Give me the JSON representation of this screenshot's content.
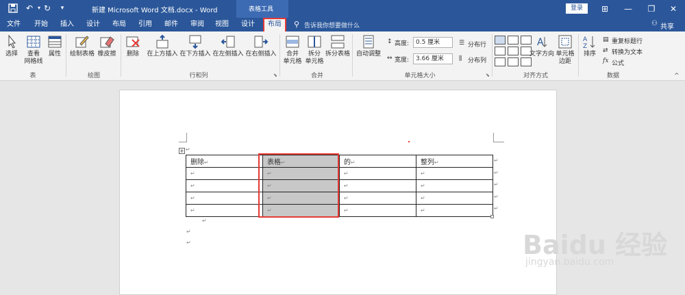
{
  "titlebar": {
    "title": "新建 Microsoft Word 文档.docx  -  Word",
    "context_tools": "表格工具",
    "login": "登录"
  },
  "tabs": [
    "文件",
    "开始",
    "插入",
    "设计",
    "布局",
    "引用",
    "邮件",
    "审阅",
    "视图",
    "设计",
    "布局"
  ],
  "tell_me": "告诉我你想要做什么",
  "share": "共享",
  "ribbon": {
    "table_group": {
      "label": "表",
      "select": "选择",
      "gridlines": "查看\n网格线",
      "properties": "属性"
    },
    "draw_group": {
      "label": "绘图",
      "draw_table": "绘制表格",
      "eraser": "橡皮擦"
    },
    "rowcol_group": {
      "label": "行和列",
      "delete": "删除",
      "insert_above": "在上方插入",
      "insert_below": "在下方插入",
      "insert_left": "在左侧插入",
      "insert_right": "在右侧插入"
    },
    "merge_group": {
      "label": "合并",
      "merge_cells": "合并\n单元格",
      "split_cells": "拆分\n单元格",
      "split_table": "拆分表格"
    },
    "cellsize_group": {
      "label": "单元格大小",
      "autofit": "自动调整",
      "height_label": "高度:",
      "height_value": "0.5 厘米",
      "width_label": "宽度:",
      "width_value": "3.66 厘米",
      "distribute_rows": "分布行",
      "distribute_cols": "分布列"
    },
    "align_group": {
      "label": "对齐方式",
      "text_direction": "文字方向",
      "cell_margins": "单元格\n边距"
    },
    "data_group": {
      "label": "数据",
      "sort": "排序",
      "repeat_header": "重复标题行",
      "convert_to_text": "转换为文本",
      "formula": "公式"
    }
  },
  "document": {
    "header_row": [
      "删除",
      "表格",
      "的",
      "整列"
    ],
    "empty_rows": 4,
    "para_mark": "↵"
  },
  "watermark": {
    "brand": "Baidu 经验",
    "url": "jingyan.baidu.com"
  },
  "colors": {
    "word_blue": "#2b579a",
    "highlight_red": "#e53935",
    "selection_gray": "#c8c8c8"
  }
}
